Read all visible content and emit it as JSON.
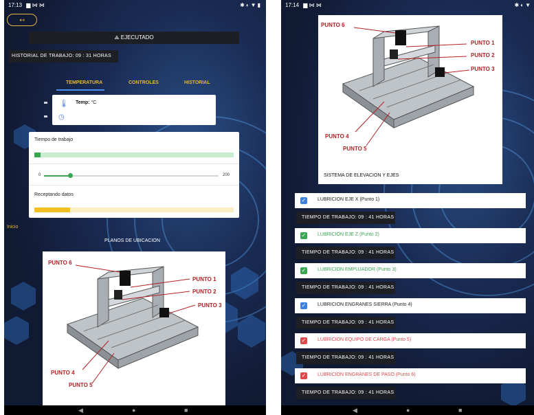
{
  "left_screen": {
    "status": {
      "time": "17:13"
    },
    "back_button": {
      "label": "↤"
    },
    "exec_bar": {
      "label": "EJECUTADO"
    },
    "history": {
      "label": "HISTORIAL DE TRABAJO:",
      "value": "09 : 31 HORAS"
    },
    "tabs": [
      {
        "label": "TEMPERATURA",
        "active": true
      },
      {
        "label": "CONTROLES",
        "active": false
      },
      {
        "label": "HISTORIAL",
        "active": false
      }
    ],
    "temp_card": {
      "label": "Temp:",
      "unit": "°C"
    },
    "work_card": {
      "title": "Tiempo de trabajo",
      "progress_fraction": 0.03,
      "slider_min": "0",
      "slider_max": "200",
      "slider_value": 30,
      "receiving_title": "Receptando datos",
      "receiving_fraction": 0.18
    },
    "inicio": "Inicio",
    "planos": "PLANOS DE UBICACION",
    "diagram_labels": [
      "PUNTO 6",
      "PUNTO 1",
      "PUNTO 2",
      "PUNTO 3",
      "PUNTO 4",
      "PUNTO 5"
    ]
  },
  "right_screen": {
    "status": {
      "time": "17:14"
    },
    "diagram_labels": [
      "PUNTO 6",
      "PUNTO 1",
      "PUNTO 2",
      "PUNTO 3",
      "PUNTO 4",
      "PUNTO 5"
    ],
    "system_label": "SISTEMA DE ELEVACION Y EJES",
    "lubrications": [
      {
        "label": "LUBRICION EJE X (Punto 1)",
        "checkbox_color": "#3b82e0",
        "text_color": "#222222",
        "time_label": "TIEMPO DE TRABAJO:",
        "time_value": "09 : 41 HORAS"
      },
      {
        "label": "LUBRICION EJE Z (Punto 2)",
        "checkbox_color": "#39a852",
        "text_color": "#39a852",
        "time_label": "TIEMPO DE TRABAJO:",
        "time_value": "09 : 41 HORAS"
      },
      {
        "label": "LUBRICION EMPUJADOR (Punto 3)",
        "checkbox_color": "#39a852",
        "text_color": "#39a852",
        "time_label": "TIEMPO DE TRABAJO:",
        "time_value": "09 : 41 HORAS"
      },
      {
        "label": "LUBRICION ENGRANES SIERRA (Punto 4)",
        "checkbox_color": "#3b82e0",
        "text_color": "#222222",
        "time_label": "TIEMPO DE TRABAJO:",
        "time_value": "09 : 41 HORAS"
      },
      {
        "label": "LUBRICION EQUIPO DE CARGA (Punto 5)",
        "checkbox_color": "#e0494c",
        "text_color": "#e0494c",
        "time_label": "TIEMPO DE TRABAJO:",
        "time_value": "09 : 41 HORAS"
      },
      {
        "label": "LUBRICION ENGRANES DE PASO (Punto 6)",
        "checkbox_color": "#e0494c",
        "text_color": "#e0494c",
        "time_label": "TIEMPO DE TRABAJO:",
        "time_value": "09 : 41 HORAS"
      }
    ]
  },
  "nav_icons": [
    "back-triangle",
    "home-circle",
    "recents-square"
  ],
  "colors": {
    "accent_gold": "#e8b634",
    "tab_underline": "#4a8ef0",
    "dark_bar": "#1d1f24",
    "label_red": "#b51f24"
  }
}
